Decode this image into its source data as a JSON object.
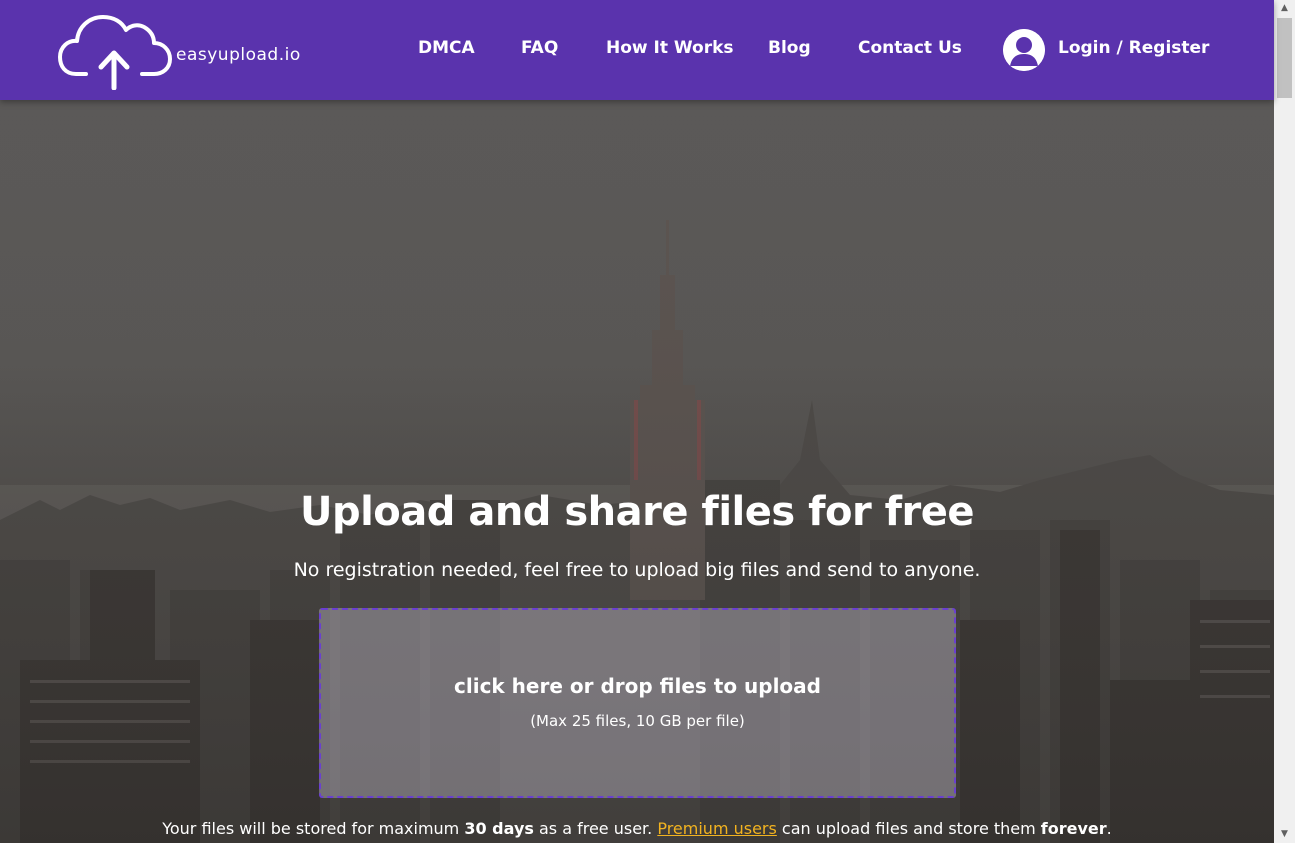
{
  "brand": {
    "logo_text": "easyupload.io",
    "logo_icon": "cloud-upload-icon"
  },
  "nav": {
    "items": [
      {
        "label": "DMCA"
      },
      {
        "label": "FAQ"
      },
      {
        "label": "How It Works"
      },
      {
        "label": "Blog"
      },
      {
        "label": "Contact Us"
      }
    ],
    "login_label": "Login / Register",
    "avatar_icon": "user-avatar-icon"
  },
  "hero": {
    "title": "Upload and share files for free",
    "subtitle": "No registration needed, feel free to upload big files and send to anyone.",
    "dropzone": {
      "main": "click here or drop files to upload",
      "sub": "(Max 25 files, 10 GB per file)"
    },
    "info": {
      "p1": "Your files will be stored for maximum ",
      "b1": "30 days",
      "p2": " as a free user. ",
      "link": "Premium users",
      "p3": " can upload files and store them ",
      "b2": "forever",
      "p4": "."
    }
  },
  "colors": {
    "header_bg": "#5a33ad",
    "dropzone_border": "#6a3fd0",
    "link": "#f2b320"
  }
}
